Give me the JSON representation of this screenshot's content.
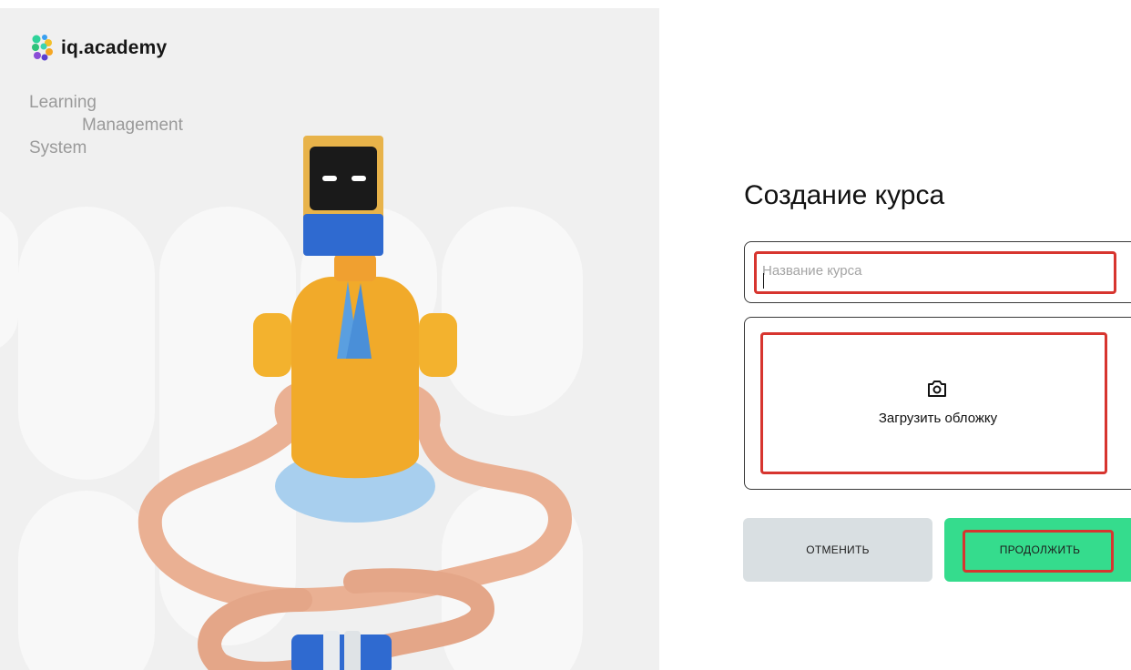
{
  "brand": {
    "name": "iq.academy",
    "tagline_lines": [
      "Learning",
      "Management",
      "System"
    ]
  },
  "form": {
    "title": "Создание курса",
    "course_name": {
      "placeholder": "Название курса",
      "value": ""
    },
    "cover_upload": {
      "label": "Загрузить обложку",
      "icon": "camera-icon"
    },
    "buttons": {
      "cancel": "ОТМЕНИТЬ",
      "continue": "ПРОДОЛЖИТЬ"
    }
  },
  "colors": {
    "accent_green": "#35dc8d",
    "cancel_gray": "#d9dfe2",
    "highlight_red": "#d7352f",
    "panel_bg": "#f0f0f0"
  }
}
